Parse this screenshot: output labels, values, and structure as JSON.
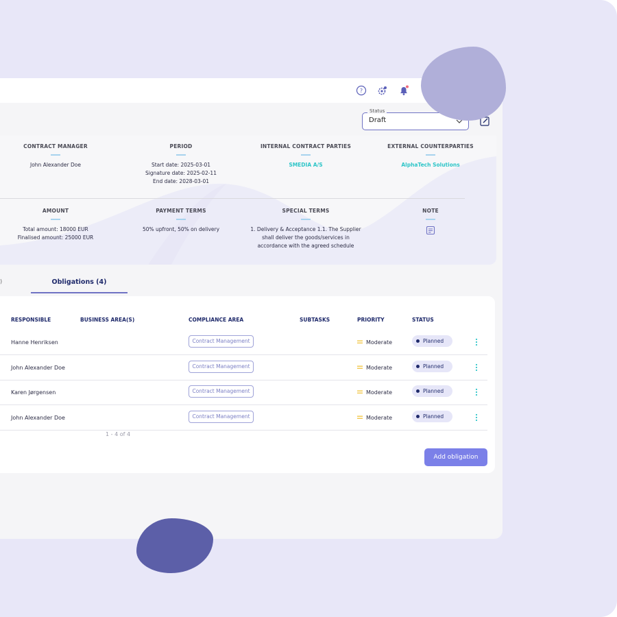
{
  "status": {
    "legend": "Status",
    "value": "Draft"
  },
  "info": {
    "contract_manager": {
      "label": "CONTRACT MANAGER",
      "value": "John Alexander Doe"
    },
    "period": {
      "label": "PERIOD",
      "start": "Start date: 2025-03-01",
      "signature": "Signature date: 2025-02-11",
      "end": "End date: 2028-03-01"
    },
    "internal_parties": {
      "label": "INTERNAL CONTRACT PARTIES",
      "value": "SMEDIA A/S"
    },
    "external_counterparties": {
      "label": "EXTERNAL COUNTERPARTIES",
      "value": "AlphaTech Solutions"
    },
    "amount": {
      "label": "AMOUNT",
      "total": "Total amount: 18000 EUR",
      "finalised": "Finalised amount: 25000 EUR"
    },
    "payment_terms": {
      "label": "PAYMENT TERMS",
      "value": "50% upfront, 50% on delivery"
    },
    "special_terms": {
      "label": "SPECIAL TERMS",
      "line1": "1. Delivery & Acceptance 1.1. The Supplier",
      "line2": "shall deliver the goods/services in",
      "line3": "accordance with the agreed schedule"
    },
    "note": {
      "label": "NOTE"
    }
  },
  "tabs": {
    "previous_fragment": ")",
    "obligations": "Obligations (4)"
  },
  "table": {
    "headers": {
      "responsible": "RESPONSIBLE",
      "business_areas": "BUSINESS AREA(S)",
      "compliance_area": "COMPLIANCE AREA",
      "subtasks": "SUBTASKS",
      "priority": "PRIORITY",
      "status": "STATUS"
    },
    "rows": [
      {
        "responsible": "Hanne Henriksen",
        "compliance": "Contract Management",
        "priority": "Moderate",
        "status": "Planned"
      },
      {
        "responsible": "John Alexander Doe",
        "compliance": "Contract Management",
        "priority": "Moderate",
        "status": "Planned"
      },
      {
        "responsible": "Karen Jørgensen",
        "compliance": "Contract Management",
        "priority": "Moderate",
        "status": "Planned"
      },
      {
        "responsible": "John Alexander Doe",
        "compliance": "Contract Management",
        "priority": "Moderate",
        "status": "Planned"
      }
    ],
    "pagination": "1 - 4 of 4"
  },
  "actions": {
    "add_obligation": "Add obligation"
  },
  "colors": {
    "accent": "#7b80e8",
    "navy": "#1f2a6b",
    "teal_link": "#2ec5c8",
    "priority_moderate": "#f2c84b",
    "notification_dot": "#f06b7d",
    "frame_background": "#e8e7f8"
  },
  "icons": {
    "help": "help-icon",
    "settings": "settings-icon",
    "notifications": "bell-icon",
    "edit": "edit-icon",
    "note": "note-icon",
    "dropdown": "chevron-down-icon",
    "row_menu": "kebab-menu-icon"
  }
}
